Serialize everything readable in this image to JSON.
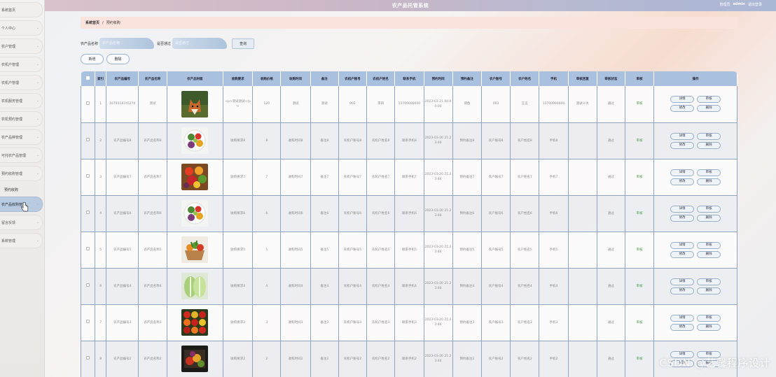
{
  "app": {
    "title": "农产品托管系统",
    "user_role": "管理员",
    "username": "admin",
    "logout_label": "退出登录"
  },
  "sidebar": {
    "items": [
      {
        "label": "系统首页",
        "has_chevron": false
      },
      {
        "label": "个人中心",
        "has_chevron": true
      },
      {
        "label": "农户管理",
        "has_chevron": true
      },
      {
        "label": "农机户管理",
        "has_chevron": true
      },
      {
        "label": "农机户管理",
        "has_chevron": true
      },
      {
        "label": "农机服务管理",
        "has_chevron": true
      },
      {
        "label": "农机预约管理",
        "has_chevron": true
      },
      {
        "label": "农产品种管理",
        "has_chevron": true
      },
      {
        "label": "可托农产品管理",
        "has_chevron": true
      },
      {
        "label": "预约收购管理",
        "has_chevron": true
      }
    ],
    "sub_item": "预约收购",
    "active_item": "农产品收购管理",
    "bottom_items": [
      {
        "label": "留言反馈",
        "has_chevron": true
      },
      {
        "label": "系统管理",
        "has_chevron": true
      }
    ]
  },
  "breadcrumb": {
    "home": "系统首页",
    "separator": "/",
    "current": "预约收购"
  },
  "search": {
    "field1_label": "农产品名称",
    "field1_placeholder": "农产品名称",
    "field2_label": "是否通过",
    "field2_placeholder": "是否通过",
    "button_label": "查询"
  },
  "actions": {
    "add_label": "新增",
    "delete_label": "删除"
  },
  "table": {
    "columns": [
      "索引",
      "农产品编号",
      "农产品名称",
      "农产品封面",
      "收购要求",
      "收购价格",
      "收购时间",
      "备注",
      "农机户账号",
      "农机户姓名",
      "联系手机",
      "预约时间",
      "预约备注",
      "农户账号",
      "农户姓名",
      "手机",
      "审核回复",
      "审核状态",
      "审核",
      "操作"
    ],
    "row_buttons": {
      "detail": "详情",
      "audit": "审核",
      "edit": "修改",
      "delete": "删除"
    },
    "rows": [
      {
        "index": "1",
        "code": "1679318745274",
        "name": "测试",
        "img": "fox",
        "req": "<p>测试测试</p>",
        "price": "120",
        "time": "测试",
        "note": "测试",
        "mach_acct": "002",
        "mach_name": "李四",
        "phone": "13700000000",
        "appt_time": "2023-03-21 00:00:00",
        "appt_note": "测色",
        "farm_acct": "003",
        "farm_name": "王五",
        "farm_phone": "13700000000",
        "reply": "测试十大",
        "status": "通过",
        "audit": "审核"
      },
      {
        "index": "2",
        "code": "农产品编号8",
        "name": "农产品名称8",
        "img": "veg-plate",
        "req": "收购要求8",
        "price": "8",
        "time": "收购时间8",
        "note": "备注8",
        "mach_acct": "农机户账号8",
        "mach_name": "农机户姓名8",
        "phone": "联系手机8",
        "appt_time": "2023-03-20 21:23:46",
        "appt_note": "预约备注8",
        "farm_acct": "农户账号8",
        "farm_name": "农户姓名8",
        "farm_phone": "手机8",
        "reply": "",
        "status": "通过",
        "audit": "审核"
      },
      {
        "index": "3",
        "code": "农产品编号7",
        "name": "农产品名称7",
        "img": "produce",
        "req": "收购要求7",
        "price": "7",
        "time": "收购时间7",
        "note": "备注7",
        "mach_acct": "农机户账号7",
        "mach_name": "农机户姓名7",
        "phone": "联系手机7",
        "appt_time": "2023-03-20 21:23:46",
        "appt_note": "预约备注7",
        "farm_acct": "农户账号7",
        "farm_name": "农户姓名7",
        "farm_phone": "手机7",
        "reply": "",
        "status": "通过",
        "audit": "审核"
      },
      {
        "index": "4",
        "code": "农产品编号6",
        "name": "农产品名称6",
        "img": "veg-plate",
        "req": "收购要求6",
        "price": "6",
        "time": "收购时间6",
        "note": "备注6",
        "mach_acct": "农机户账号6",
        "mach_name": "农机户姓名6",
        "phone": "联系手机6",
        "appt_time": "2023-03-20 21:23:46",
        "appt_note": "预约备注6",
        "farm_acct": "农户账号6",
        "farm_name": "农户姓名6",
        "farm_phone": "手机6",
        "reply": "",
        "status": "通过",
        "audit": "审核"
      },
      {
        "index": "5",
        "code": "农产品编号5",
        "name": "农产品名称5",
        "img": "basket",
        "req": "收购要求5",
        "price": "5",
        "time": "收购时间5",
        "note": "备注5",
        "mach_acct": "农机户账号5",
        "mach_name": "农机户姓名5",
        "phone": "联系手机5",
        "appt_time": "2023-03-20 21:23:46",
        "appt_note": "预约备注5",
        "farm_acct": "农户账号5",
        "farm_name": "农户姓名5",
        "farm_phone": "手机5",
        "reply": "",
        "status": "通过",
        "audit": "审核"
      },
      {
        "index": "6",
        "code": "农产品编号4",
        "name": "农产品名称4",
        "img": "cabbage",
        "req": "收购要求4",
        "price": "4",
        "time": "收购时间4",
        "note": "备注4",
        "mach_acct": "农机户账号4",
        "mach_name": "农机户姓名4",
        "phone": "联系手机4",
        "appt_time": "2023-03-20 21:23:46",
        "appt_note": "预约备注4",
        "farm_acct": "农户账号4",
        "farm_name": "农户姓名4",
        "farm_phone": "手机4",
        "reply": "",
        "status": "通过",
        "audit": "审核"
      },
      {
        "index": "7",
        "code": "农产品编号3",
        "name": "农产品名称3",
        "img": "peppers",
        "req": "收购要求3",
        "price": "3",
        "time": "收购时间3",
        "note": "备注3",
        "mach_acct": "农机户账号3",
        "mach_name": "农机户姓名3",
        "phone": "联系手机3",
        "appt_time": "2023-03-20 21:23:46",
        "appt_note": "预约备注3",
        "farm_acct": "农户账号3",
        "farm_name": "农户姓名3",
        "farm_phone": "手机3",
        "reply": "",
        "status": "通过",
        "audit": "审核"
      },
      {
        "index": "8",
        "code": "农产品编号2",
        "name": "农产品名称2",
        "img": "fruit-dark",
        "req": "收购要求2",
        "price": "2",
        "time": "收购时间2",
        "note": "备注2",
        "mach_acct": "农机户账号2",
        "mach_name": "农机户姓名2",
        "phone": "联系手机2",
        "appt_time": "2023-03-20 21:23:44",
        "appt_note": "预约备注2",
        "farm_acct": "农户账号2",
        "farm_name": "农户姓名2",
        "farm_phone": "手机2",
        "reply": "",
        "status": "通过",
        "audit": "审核"
      }
    ]
  },
  "watermark": "CSDN @艺馨程序设计"
}
